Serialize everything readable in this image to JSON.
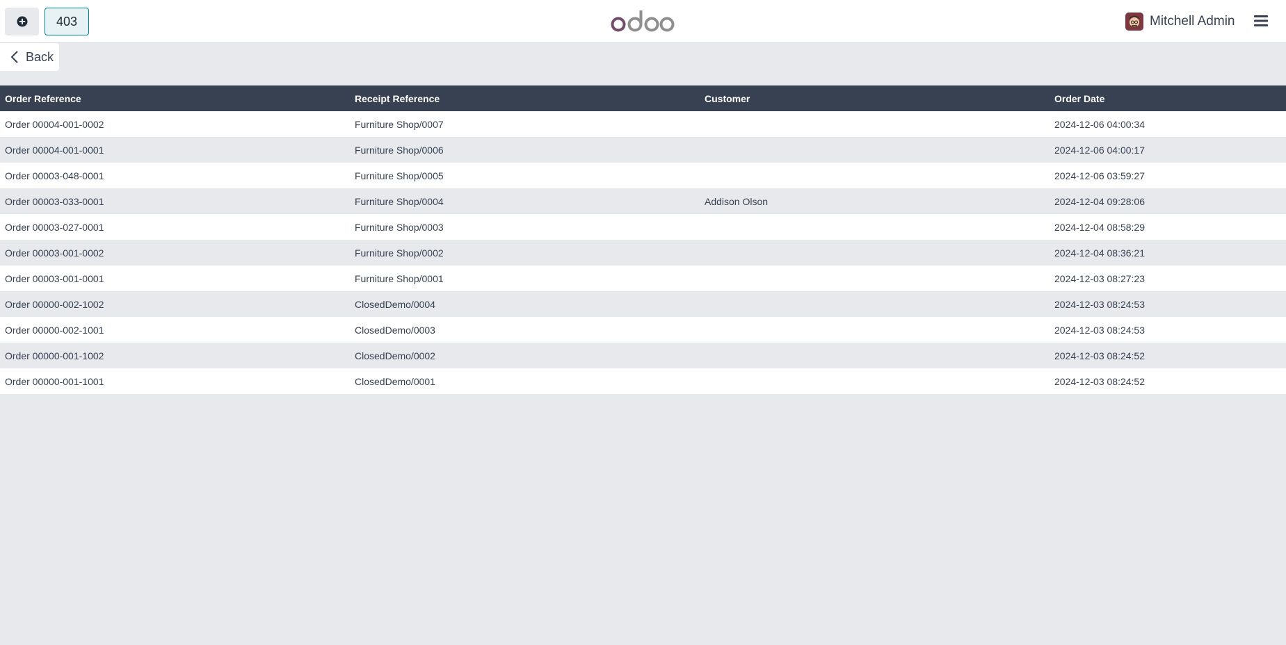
{
  "navbar": {
    "order_number": "403",
    "user_name": "Mitchell Admin",
    "icons": {
      "new_order": "plus-circle-icon",
      "logo": "odoo-logo",
      "menu": "hamburger-menu-icon"
    }
  },
  "back": {
    "label": "Back",
    "icon": "chevron-left-icon"
  },
  "table": {
    "headers": [
      "Order Reference",
      "Receipt Reference",
      "Customer",
      "Order Date"
    ],
    "rows": [
      [
        "Order 00004-001-0002",
        "Furniture Shop/0007",
        "",
        "2024-12-06 04:00:34"
      ],
      [
        "Order 00004-001-0001",
        "Furniture Shop/0006",
        "",
        "2024-12-06 04:00:17"
      ],
      [
        "Order 00003-048-0001",
        "Furniture Shop/0005",
        "",
        "2024-12-06 03:59:27"
      ],
      [
        "Order 00003-033-0001",
        "Furniture Shop/0004",
        "Addison Olson",
        "2024-12-04 09:28:06"
      ],
      [
        "Order 00003-027-0001",
        "Furniture Shop/0003",
        "",
        "2024-12-04 08:58:29"
      ],
      [
        "Order 00003-001-0002",
        "Furniture Shop/0002",
        "",
        "2024-12-04 08:36:21"
      ],
      [
        "Order 00003-001-0001",
        "Furniture Shop/0001",
        "",
        "2024-12-03 08:27:23"
      ],
      [
        "Order 00000-002-1002",
        "ClosedDemo/0004",
        "",
        "2024-12-03 08:24:53"
      ],
      [
        "Order 00000-002-1001",
        "ClosedDemo/0003",
        "",
        "2024-12-03 08:24:53"
      ],
      [
        "Order 00000-001-1002",
        "ClosedDemo/0002",
        "",
        "2024-12-03 08:24:52"
      ],
      [
        "Order 00000-001-1001",
        "ClosedDemo/0001",
        "",
        "2024-12-03 08:24:52"
      ]
    ]
  },
  "colors": {
    "header_bg": "#374151",
    "accent": "#017e84",
    "logo_purple": "#714B67",
    "logo_gray": "#8F8F8F",
    "row_alt": "#e7e9ed"
  }
}
